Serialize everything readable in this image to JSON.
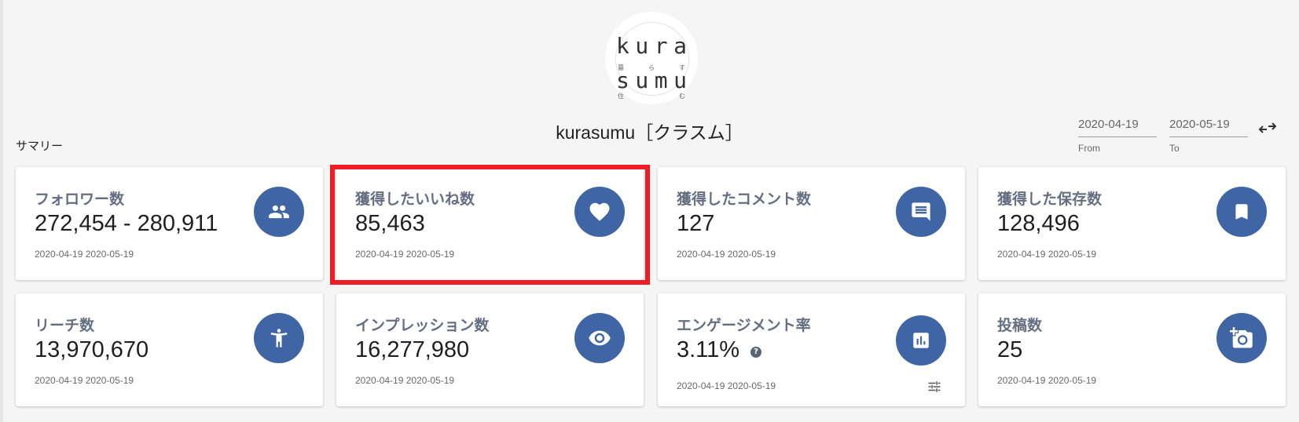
{
  "header": {
    "logo": {
      "line1": [
        "k",
        "u",
        "r",
        "a"
      ],
      "line1_small": [
        "暮",
        "ら",
        "す"
      ],
      "line2": [
        "s",
        "u",
        "m",
        "u"
      ],
      "line2_small": [
        "住",
        "む"
      ]
    },
    "account_name": "kurasumu［クラスム］",
    "section_label": "サマリー"
  },
  "date_range": {
    "from_value": "2020-04-19",
    "from_label": "From",
    "to_value": "2020-05-19",
    "to_label": "To",
    "swap_icon": "swap-arrows-icon"
  },
  "accent_color": "#3f65a4",
  "highlight_color": "#ee1c25",
  "cards": [
    {
      "title": "フォロワー数",
      "value": "272,454 - 280,911",
      "date": "2020-04-19 2020-05-19",
      "icon": "people-icon"
    },
    {
      "title": "獲得したいいね数",
      "value": "85,463",
      "date": "2020-04-19 2020-05-19",
      "icon": "heart-icon",
      "highlighted": true
    },
    {
      "title": "獲得したコメント数",
      "value": "127",
      "date": "2020-04-19 2020-05-19",
      "icon": "comment-icon"
    },
    {
      "title": "獲得した保存数",
      "value": "128,496",
      "date": "2020-04-19 2020-05-19",
      "icon": "bookmark-icon"
    },
    {
      "title": "リーチ数",
      "value": "13,970,670",
      "date": "2020-04-19 2020-05-19",
      "icon": "person-icon"
    },
    {
      "title": "インプレッション数",
      "value": "16,277,980",
      "date": "2020-04-19 2020-05-19",
      "icon": "eye-icon"
    },
    {
      "title": "エンゲージメント率",
      "value": "3.11%",
      "date": "2020-04-19 2020-05-19",
      "icon": "bar-chart-icon",
      "help": "?",
      "settings_icon": "tune-icon"
    },
    {
      "title": "投稿数",
      "value": "25",
      "date": "2020-04-19 2020-05-19",
      "icon": "add-photo-icon"
    }
  ]
}
